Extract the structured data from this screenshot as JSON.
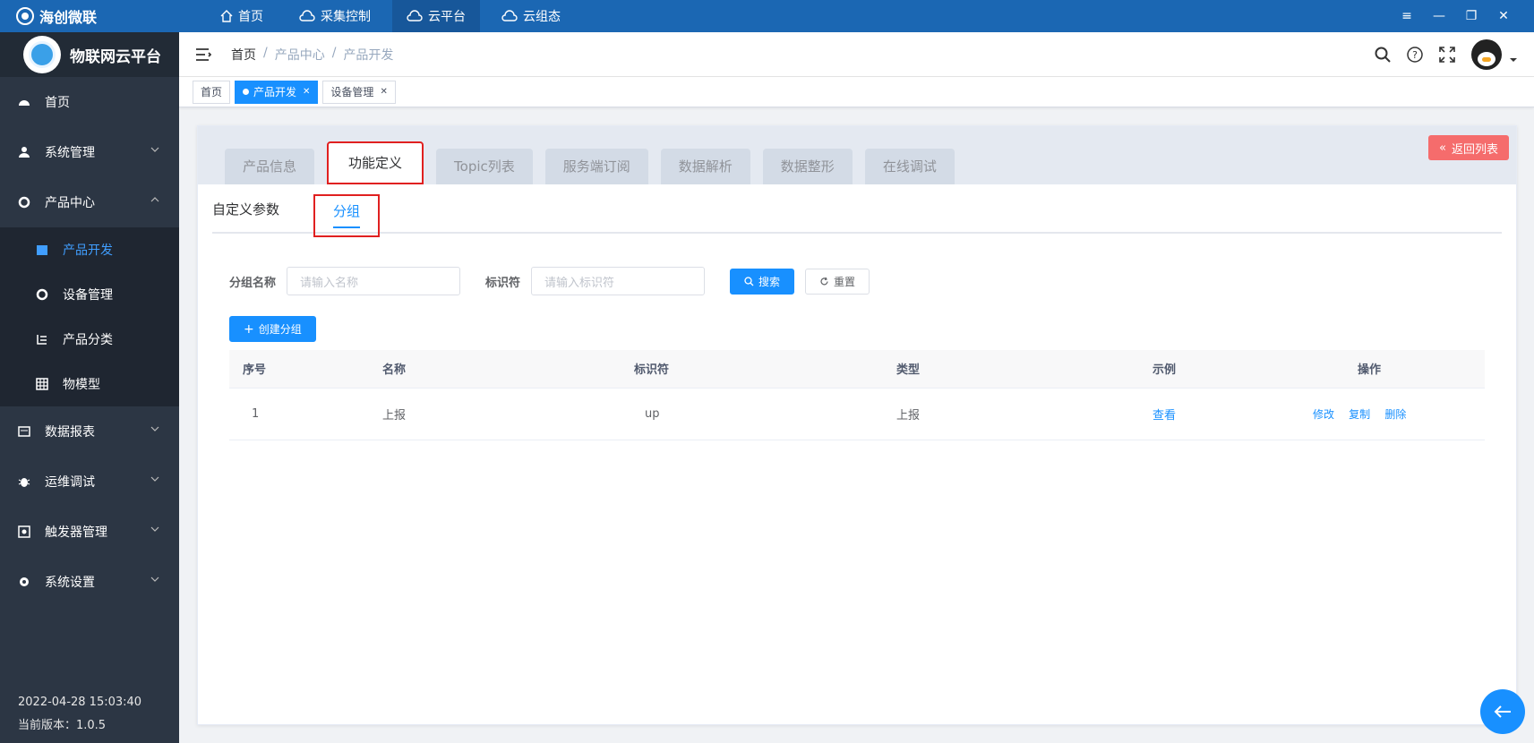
{
  "app": {
    "brand": "海创微联"
  },
  "topnav": [
    {
      "label": "首页",
      "icon": "home-icon"
    },
    {
      "label": "采集控制",
      "icon": "cloud-collect-icon"
    },
    {
      "label": "云平台",
      "icon": "cloud-platform-icon"
    },
    {
      "label": "云组态",
      "icon": "cloud-config-icon"
    }
  ],
  "sidebar": {
    "title": "物联网云平台",
    "items": [
      {
        "label": "首页",
        "icon": "dashboard-icon"
      },
      {
        "label": "系统管理",
        "icon": "user-icon"
      },
      {
        "label": "产品中心",
        "icon": "product-icon"
      }
    ],
    "subitems": [
      {
        "label": "产品开发",
        "icon": "folder-icon"
      },
      {
        "label": "设备管理",
        "icon": "device-icon"
      },
      {
        "label": "产品分类",
        "icon": "tree-icon"
      },
      {
        "label": "物模型",
        "icon": "grid-icon"
      }
    ],
    "items2": [
      {
        "label": "数据报表",
        "icon": "report-icon"
      },
      {
        "label": "运维调试",
        "icon": "bug-icon"
      },
      {
        "label": "触发器管理",
        "icon": "trigger-icon"
      },
      {
        "label": "系统设置",
        "icon": "gear-icon"
      }
    ],
    "datetime": "2022-04-28 15:03:40",
    "version": "当前版本：1.0.5"
  },
  "breadcrumb": [
    "首页",
    "/",
    "产品中心",
    "/",
    "产品开发"
  ],
  "tags": [
    {
      "label": "首页"
    },
    {
      "label": "产品开发"
    },
    {
      "label": "设备管理"
    }
  ],
  "tabs": [
    "产品信息",
    "功能定义",
    "Topic列表",
    "服务端订阅",
    "数据解析",
    "数据整形",
    "在线调试"
  ],
  "back_label": "返回列表",
  "subtabs": [
    "自定义参数",
    "分组"
  ],
  "filters": {
    "name_label": "分组名称",
    "name_placeholder": "请输入名称",
    "id_label": "标识符",
    "id_placeholder": "请输入标识符",
    "search_label": "搜索",
    "reset_label": "重置"
  },
  "create_label": "创建分组",
  "table": {
    "headers": [
      "序号",
      "名称",
      "标识符",
      "类型",
      "示例",
      "操作"
    ],
    "rows": [
      {
        "index": "1",
        "name": "上报",
        "identifier": "up",
        "type": "上报",
        "example": "查看",
        "ops": [
          "修改",
          "复制",
          "删除"
        ]
      }
    ]
  }
}
